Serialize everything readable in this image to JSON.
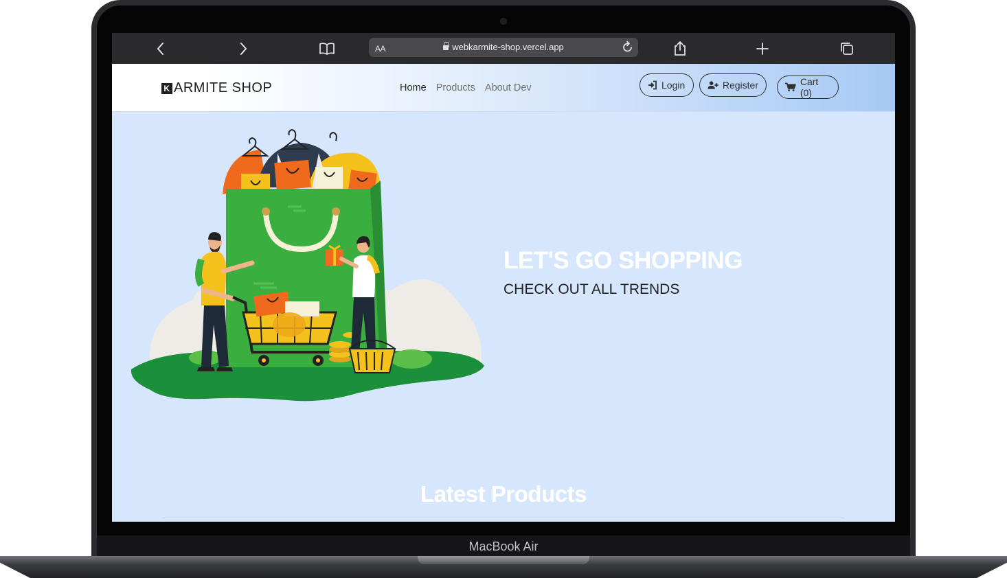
{
  "device": {
    "label": "MacBook Air"
  },
  "browser": {
    "address_text_size": "AA",
    "url": "webkarmite-shop.vercel.app",
    "icons": [
      "chevron-left-icon",
      "chevron-right-icon",
      "book-icon",
      "lock-icon",
      "reload-icon",
      "share-icon",
      "plus-icon",
      "tabs-icon"
    ]
  },
  "navbar": {
    "brand_mark": "K",
    "brand_text": "ARMITE SHOP",
    "links": [
      {
        "label": "Home",
        "active": true
      },
      {
        "label": "Products",
        "active": false
      },
      {
        "label": "About Dev",
        "active": false
      }
    ],
    "login_label": "Login",
    "register_label": "Register",
    "cart_label": "Cart (0)"
  },
  "hero": {
    "title": "LET'S GO SHOPPING",
    "subtitle": "CHECK OUT ALL TRENDS"
  },
  "latest": {
    "title": "Latest Products"
  },
  "colors": {
    "page_background": "#d6e6fc",
    "browser_chrome": "#2a2a2c",
    "bag_green": "#3aae3f",
    "ground_green": "#1c8f3a",
    "accent_orange": "#f06a1e",
    "accent_yellow": "#f5c21d"
  }
}
